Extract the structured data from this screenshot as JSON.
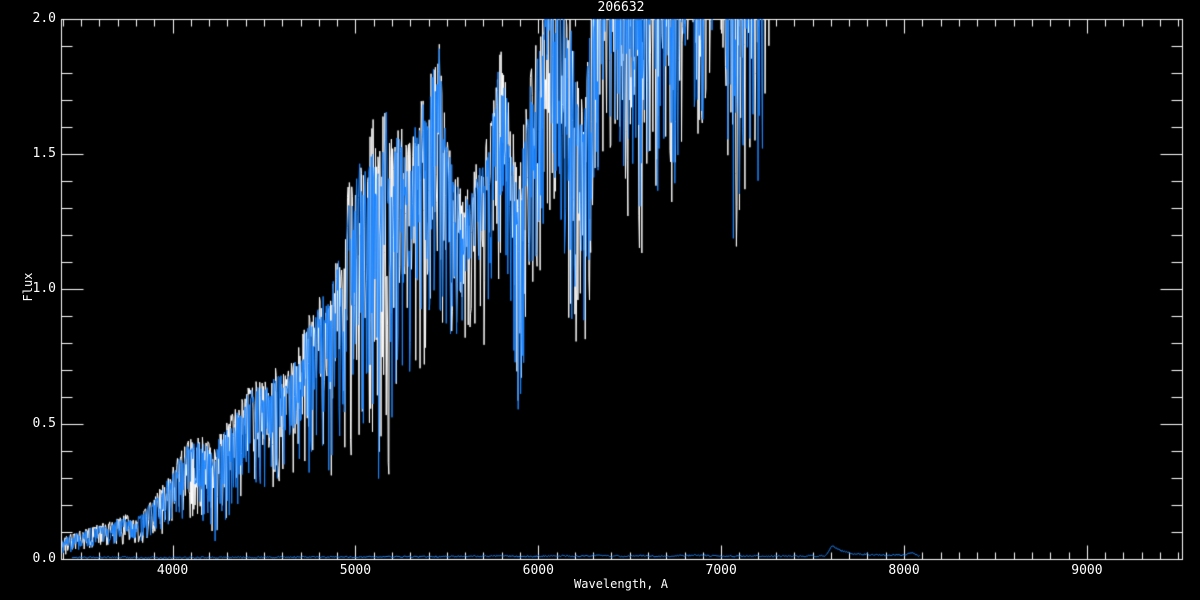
{
  "window": {
    "background": "#000000"
  },
  "chart_data": {
    "type": "line",
    "title": "206632",
    "xlabel": "Wavelength, A",
    "ylabel": "Flux",
    "x_range": [
      3390,
      9520
    ],
    "y_range": [
      0.0,
      2.0
    ],
    "x_major_ticks": [
      4000,
      5000,
      6000,
      7000,
      8000,
      9000
    ],
    "x_tick_labels": [
      "4000",
      "5000",
      "6000",
      "7000",
      "8000",
      "9000"
    ],
    "x_minor_tick_step": 100,
    "y_major_ticks": [
      0.0,
      0.5,
      1.0,
      1.5,
      2.0
    ],
    "y_tick_labels": [
      "0.0",
      "0.5",
      "1.0",
      "1.5",
      "2.0"
    ],
    "y_minor_tick_step": 0.1,
    "grid": false,
    "legend": null,
    "axis_color": "#FFFFFF",
    "background_color": "#000000",
    "series": [
      {
        "name": "spectrum-underlay",
        "color": "#FFFFFF",
        "style": "noisy-envelope",
        "source": "main_envelope"
      },
      {
        "name": "spectrum-overlay",
        "color": "#1E86FF",
        "style": "noisy-envelope",
        "source": "main_envelope"
      },
      {
        "name": "near-zero-spectrum",
        "color": "#1E86FF",
        "style": "line",
        "source": "low_spectrum"
      }
    ],
    "main_envelope": [
      [
        3395,
        0.02,
        0.07
      ],
      [
        3430,
        0.02,
        0.085
      ],
      [
        3470,
        0.03,
        0.095
      ],
      [
        3510,
        0.035,
        0.105
      ],
      [
        3550,
        0.04,
        0.115
      ],
      [
        3590,
        0.045,
        0.125
      ],
      [
        3630,
        0.05,
        0.13
      ],
      [
        3670,
        0.05,
        0.14
      ],
      [
        3710,
        0.055,
        0.15
      ],
      [
        3750,
        0.06,
        0.16
      ],
      [
        3790,
        0.05,
        0.14
      ],
      [
        3830,
        0.065,
        0.17
      ],
      [
        3870,
        0.075,
        0.2
      ],
      [
        3910,
        0.085,
        0.23
      ],
      [
        3950,
        0.1,
        0.27
      ],
      [
        3990,
        0.12,
        0.31
      ],
      [
        4030,
        0.14,
        0.37
      ],
      [
        4070,
        0.15,
        0.41
      ],
      [
        4110,
        0.16,
        0.44
      ],
      [
        4150,
        0.16,
        0.45
      ],
      [
        4190,
        0.1,
        0.42
      ],
      [
        4226,
        0.03,
        0.38
      ],
      [
        4260,
        0.15,
        0.46
      ],
      [
        4300,
        0.14,
        0.5
      ],
      [
        4340,
        0.19,
        0.54
      ],
      [
        4380,
        0.22,
        0.58
      ],
      [
        4420,
        0.23,
        0.62
      ],
      [
        4460,
        0.25,
        0.64
      ],
      [
        4500,
        0.26,
        0.63
      ],
      [
        4540,
        0.28,
        0.66
      ],
      [
        4580,
        0.3,
        0.7
      ],
      [
        4620,
        0.27,
        0.66
      ],
      [
        4660,
        0.32,
        0.72
      ],
      [
        4700,
        0.34,
        0.8
      ],
      [
        4740,
        0.3,
        0.86
      ],
      [
        4780,
        0.36,
        0.92
      ],
      [
        4820,
        0.38,
        0.99
      ],
      [
        4861,
        0.28,
        0.96
      ],
      [
        4900,
        0.42,
        1.12
      ],
      [
        4935,
        0.36,
        1.06
      ],
      [
        4960,
        0.48,
        1.35
      ],
      [
        4990,
        0.4,
        1.32
      ],
      [
        5020,
        0.3,
        1.48
      ],
      [
        5050,
        0.45,
        1.45
      ],
      [
        5080,
        0.5,
        1.58
      ],
      [
        5110,
        0.42,
        1.55
      ],
      [
        5140,
        0.2,
        1.42
      ],
      [
        5165,
        0.27,
        1.83
      ],
      [
        5190,
        0.38,
        1.52
      ],
      [
        5220,
        0.58,
        1.56
      ],
      [
        5250,
        0.68,
        1.58
      ],
      [
        5280,
        0.45,
        1.48
      ],
      [
        5310,
        0.72,
        1.56
      ],
      [
        5340,
        0.7,
        1.64
      ],
      [
        5370,
        0.78,
        1.72
      ],
      [
        5400,
        0.76,
        1.7
      ],
      [
        5430,
        0.84,
        1.88
      ],
      [
        5455,
        0.95,
        1.94
      ],
      [
        5480,
        0.8,
        1.66
      ],
      [
        5510,
        0.85,
        1.52
      ],
      [
        5540,
        0.8,
        1.42
      ],
      [
        5570,
        0.85,
        1.38
      ],
      [
        5600,
        0.76,
        1.32
      ],
      [
        5630,
        0.8,
        1.36
      ],
      [
        5660,
        0.85,
        1.43
      ],
      [
        5700,
        0.8,
        1.48
      ],
      [
        5730,
        0.9,
        1.58
      ],
      [
        5760,
        1.0,
        1.72
      ],
      [
        5790,
        1.04,
        1.86
      ],
      [
        5820,
        0.98,
        1.78
      ],
      [
        5850,
        0.8,
        1.62
      ],
      [
        5890,
        0.48,
        1.36
      ],
      [
        5920,
        0.7,
        1.56
      ],
      [
        5950,
        0.9,
        1.72
      ],
      [
        5980,
        1.0,
        1.87
      ],
      [
        6010,
        1.1,
        1.97
      ],
      [
        6040,
        1.2,
        2.06
      ],
      [
        6070,
        1.3,
        2.12
      ],
      [
        6100,
        1.4,
        2.16
      ],
      [
        6130,
        1.2,
        2.1
      ],
      [
        6160,
        0.95,
        2.04
      ],
      [
        6190,
        0.85,
        1.92
      ],
      [
        6220,
        0.78,
        1.76
      ],
      [
        6250,
        0.8,
        1.66
      ],
      [
        6280,
        0.92,
        1.96
      ],
      [
        6310,
        1.3,
        2.1
      ],
      [
        6340,
        1.55,
        2.2
      ],
      [
        6370,
        1.5,
        2.22
      ],
      [
        6400,
        1.55,
        2.26
      ],
      [
        6430,
        1.6,
        2.3
      ],
      [
        6460,
        1.35,
        2.26
      ],
      [
        6500,
        1.28,
        2.22
      ],
      [
        6540,
        1.5,
        2.26
      ],
      [
        6563,
        0.9,
        2.2
      ],
      [
        6590,
        1.45,
        2.3
      ],
      [
        6620,
        1.6,
        2.32
      ],
      [
        6660,
        1.25,
        2.26
      ],
      [
        6700,
        1.55,
        2.36
      ],
      [
        6740,
        1.3,
        2.32
      ],
      [
        6780,
        1.5,
        2.36
      ],
      [
        6820,
        1.9,
        2.42
      ],
      [
        6870,
        1.45,
        2.36
      ],
      [
        6910,
        1.6,
        2.42
      ],
      [
        6950,
        1.95,
        2.48
      ],
      [
        6990,
        2.02,
        2.52
      ],
      [
        7030,
        1.6,
        2.45
      ],
      [
        7060,
        1.18,
        2.4
      ],
      [
        7090,
        1.15,
        2.32
      ],
      [
        7120,
        1.28,
        2.4
      ],
      [
        7150,
        1.45,
        2.48
      ],
      [
        7185,
        1.3,
        2.52
      ],
      [
        7215,
        1.45,
        2.56
      ],
      [
        7240,
        1.6,
        2.62
      ],
      [
        7268,
        2.02,
        2.7
      ],
      [
        7310,
        2.12,
        2.82
      ],
      [
        7400,
        2.25,
        3.0
      ]
    ],
    "low_spectrum": [
      [
        3450,
        0.005
      ],
      [
        3700,
        0.006
      ],
      [
        4000,
        0.005
      ],
      [
        4300,
        0.006
      ],
      [
        4600,
        0.007
      ],
      [
        4900,
        0.007
      ],
      [
        5200,
        0.008
      ],
      [
        5500,
        0.009
      ],
      [
        5800,
        0.011
      ],
      [
        5900,
        0.009
      ],
      [
        6000,
        0.01
      ],
      [
        6100,
        0.012
      ],
      [
        6200,
        0.01
      ],
      [
        6300,
        0.013
      ],
      [
        6400,
        0.01
      ],
      [
        6550,
        0.012
      ],
      [
        6700,
        0.01
      ],
      [
        6870,
        0.014
      ],
      [
        7000,
        0.01
      ],
      [
        7200,
        0.011
      ],
      [
        7400,
        0.01
      ],
      [
        7570,
        0.012
      ],
      [
        7605,
        0.05
      ],
      [
        7625,
        0.042
      ],
      [
        7650,
        0.032
      ],
      [
        7680,
        0.026
      ],
      [
        7720,
        0.02
      ],
      [
        7800,
        0.017
      ],
      [
        7900,
        0.014
      ],
      [
        8000,
        0.016
      ],
      [
        8050,
        0.022
      ],
      [
        8070,
        0.015
      ],
      [
        8090,
        0.01
      ]
    ]
  }
}
